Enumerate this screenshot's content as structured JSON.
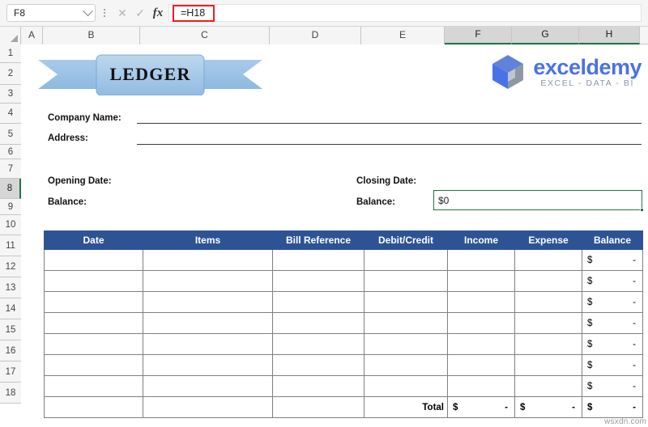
{
  "formula_bar": {
    "name_box_value": "F8",
    "formula_value": "=H18",
    "cancel_icon": "close-icon",
    "confirm_icon": "check-icon",
    "function_icon": "fx-icon",
    "highlight_color": "#ee1c25"
  },
  "grid": {
    "columns": [
      "A",
      "B",
      "C",
      "D",
      "E",
      "F",
      "G",
      "H"
    ],
    "selected_columns": [
      "F",
      "G",
      "H"
    ],
    "rows": [
      "1",
      "2",
      "3",
      "4",
      "5",
      "6",
      "7",
      "8",
      "9",
      "10",
      "11",
      "12",
      "13",
      "14",
      "15",
      "16",
      "17",
      "18"
    ],
    "selected_row": "8"
  },
  "banner": {
    "title": "LEDGER",
    "fill_color": "#9dc3e6",
    "edge_color": "#7aa9d6"
  },
  "logo": {
    "name": "exceldemy",
    "tagline": "EXCEL - DATA - BI",
    "brand_color": "#4a72e8",
    "tag_color": "#8b96a8"
  },
  "form": {
    "company_name_label": "Company Name:",
    "address_label": "Address:",
    "opening_date_label": "Opening Date:",
    "opening_balance_label": "Balance:",
    "closing_date_label": "Closing Date:",
    "closing_balance_label": "Balance:",
    "closing_balance_value": "$0"
  },
  "table": {
    "headers": [
      "Date",
      "Items",
      "Bill Reference",
      "Debit/Credit",
      "Income",
      "Expense",
      "Balance"
    ],
    "header_color": "#2e5395",
    "total_row_color": "#cfe0b4",
    "rows": [
      {
        "date": "",
        "items": "",
        "bill_reference": "",
        "debit_credit": "",
        "income": "",
        "expense": "",
        "balance_currency": "$",
        "balance_amount": "-"
      },
      {
        "date": "",
        "items": "",
        "bill_reference": "",
        "debit_credit": "",
        "income": "",
        "expense": "",
        "balance_currency": "$",
        "balance_amount": "-"
      },
      {
        "date": "",
        "items": "",
        "bill_reference": "",
        "debit_credit": "",
        "income": "",
        "expense": "",
        "balance_currency": "$",
        "balance_amount": "-"
      },
      {
        "date": "",
        "items": "",
        "bill_reference": "",
        "debit_credit": "",
        "income": "",
        "expense": "",
        "balance_currency": "$",
        "balance_amount": "-"
      },
      {
        "date": "",
        "items": "",
        "bill_reference": "",
        "debit_credit": "",
        "income": "",
        "expense": "",
        "balance_currency": "$",
        "balance_amount": "-"
      },
      {
        "date": "",
        "items": "",
        "bill_reference": "",
        "debit_credit": "",
        "income": "",
        "expense": "",
        "balance_currency": "$",
        "balance_amount": "-"
      },
      {
        "date": "",
        "items": "",
        "bill_reference": "",
        "debit_credit": "",
        "income": "",
        "expense": "",
        "balance_currency": "$",
        "balance_amount": "-"
      }
    ],
    "total": {
      "label": "Total",
      "income_currency": "$",
      "income_amount": "-",
      "expense_currency": "$",
      "expense_amount": "-",
      "balance_currency": "$",
      "balance_amount": "-"
    }
  },
  "watermark": "wsxdn.com"
}
